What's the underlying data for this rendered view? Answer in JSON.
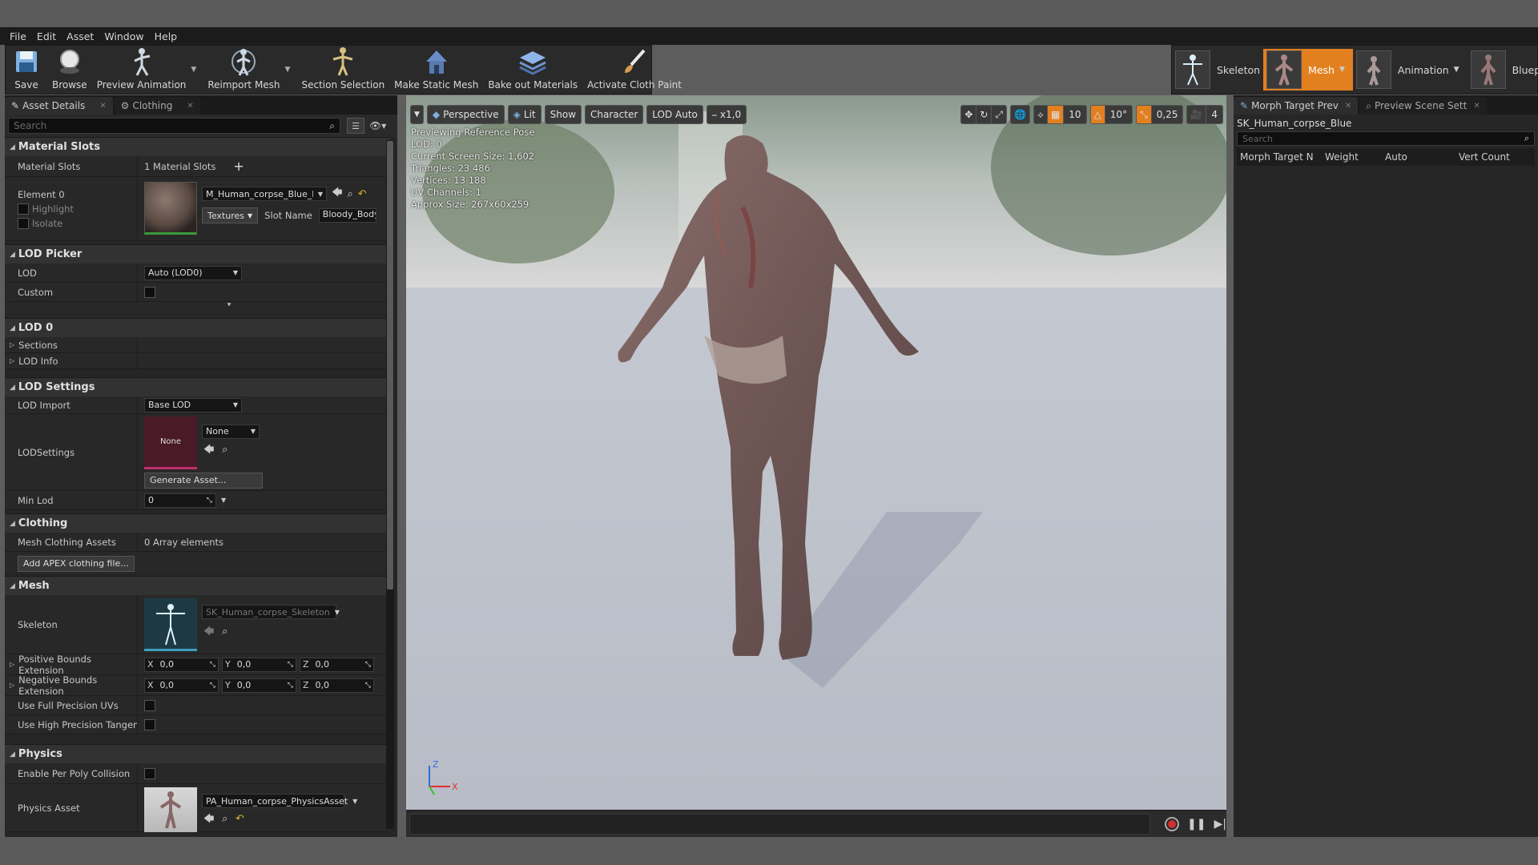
{
  "menu": [
    "File",
    "Edit",
    "Asset",
    "Window",
    "Help"
  ],
  "toolbar": {
    "save": "Save",
    "browse": "Browse",
    "preview_animation": "Preview Animation",
    "reimport_mesh": "Reimport Mesh",
    "section_selection": "Section Selection",
    "make_static_mesh": "Make Static Mesh",
    "bake_out_materials": "Bake out Materials",
    "activate_cloth_paint": "Activate Cloth Paint"
  },
  "modes": {
    "skeleton": "Skeleton",
    "mesh": "Mesh",
    "animation": "Animation",
    "blueprint": "Blueprint"
  },
  "details": {
    "tabs": [
      "Asset Details",
      "Clothing"
    ],
    "search_placeholder": "Search",
    "material_slots": {
      "title": "Material Slots",
      "label": "Material Slots",
      "count": "1 Material Slots",
      "element": "Element 0",
      "highlight": "Highlight",
      "isolate": "Isolate",
      "material_name": "M_Human_corpse_Blue_NoH",
      "textures": "Textures",
      "slot_name_label": "Slot Name",
      "slot_name_value": "Bloody_Body"
    },
    "lod_picker": {
      "title": "LOD Picker",
      "lod_label": "LOD",
      "lod_value": "Auto (LOD0)",
      "custom_label": "Custom"
    },
    "lod0": {
      "title": "LOD 0",
      "sections": "Sections",
      "lod_info": "LOD Info"
    },
    "lod_settings": {
      "title": "LOD Settings",
      "lod_import_label": "LOD Import",
      "lod_import_value": "Base LOD",
      "lodsettings_label": "LODSettings",
      "thumb_text": "None",
      "none_value": "None",
      "generate": "Generate Asset...",
      "min_lod_label": "Min Lod",
      "min_lod_value": "0"
    },
    "clothing": {
      "title": "Clothing",
      "assets_label": "Mesh Clothing Assets",
      "assets_value": "0 Array elements",
      "add_apex": "Add APEX clothing file..."
    },
    "mesh": {
      "title": "Mesh",
      "skeleton_label": "Skeleton",
      "skeleton_value": "SK_Human_corpse_Skeleton",
      "pos_bounds_label": "Positive Bounds Extension",
      "neg_bounds_label": "Negative Bounds Extension",
      "axes": [
        "X",
        "Y",
        "Z"
      ],
      "pos_values": [
        "0,0",
        "0,0",
        "0,0"
      ],
      "neg_values": [
        "0,0",
        "0,0",
        "0,0"
      ],
      "full_precision_uvs": "Use Full Precision UVs",
      "high_precision_tangent": "Use High Precision Tangent B"
    },
    "physics": {
      "title": "Physics",
      "per_poly_label": "Enable Per Poly Collision",
      "physics_asset_label": "Physics Asset",
      "physics_asset_value": "PA_Human_corpse_PhysicsAsset"
    }
  },
  "viewport": {
    "perspective": "Perspective",
    "lit": "Lit",
    "show": "Show",
    "character": "Character",
    "lod": "LOD Auto",
    "speed": "x1,0",
    "grid_snap": "10",
    "rot_snap": "10°",
    "scale_snap": "0,25",
    "cam_speed": "4",
    "stats": [
      "Previewing Reference Pose",
      "LOD: 0",
      "Current Screen Size: 1,602",
      "Triangles: 23 486",
      "Vertices: 13 188",
      "UV Channels: 1",
      "Approx Size: 267x60x259"
    ],
    "axis_x": "X",
    "axis_z": "Z"
  },
  "right_panel": {
    "tabs": [
      "Morph Target Prev",
      "Preview Scene Sett"
    ],
    "mesh_name": "SK_Human_corpse_Blue",
    "search_placeholder": "Search",
    "columns": [
      "Morph Target N",
      "Weight",
      "Auto",
      "Vert Count"
    ]
  },
  "colors": {
    "accent_orange": "#e28020",
    "panel_bg": "#262626",
    "record_red": "#d03030"
  }
}
